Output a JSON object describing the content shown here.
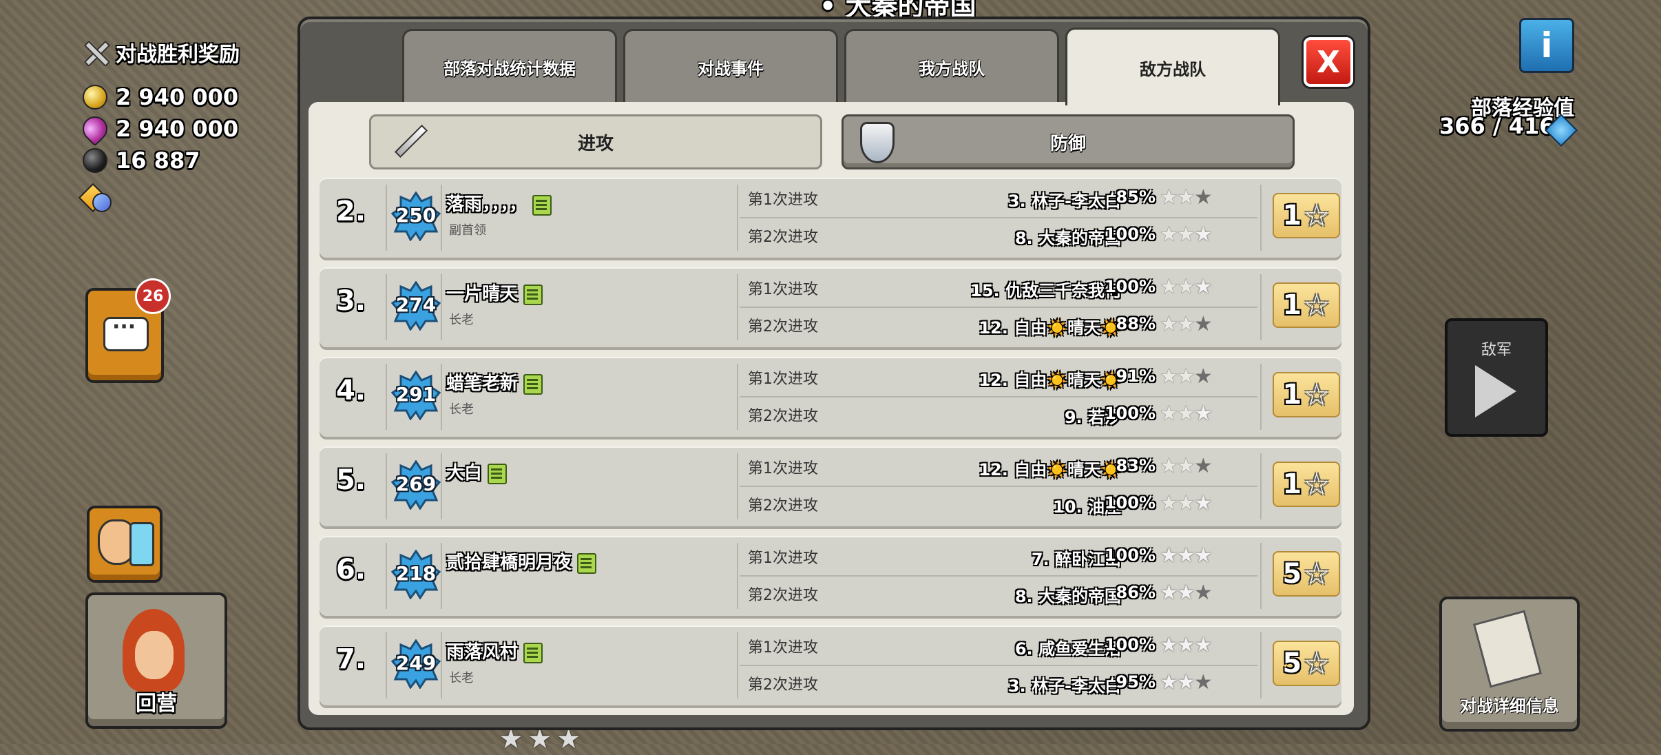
{
  "top_title": "• 大秦的帝国",
  "left": {
    "reward_title": "对战胜利奖励",
    "gold": "2 940 000",
    "elixir": "2 940 000",
    "dark_elixir": "16 887",
    "chat_badge": "26",
    "return_label": "回营"
  },
  "right": {
    "info_label": "i",
    "exp_label": "部落经验值",
    "exp_value": "366 / 416",
    "enemy_label": "敌军",
    "detail_label": "对战详细信息"
  },
  "tabs": [
    "部落对战统计数据",
    "对战事件",
    "我方战队",
    "敌方战队"
  ],
  "active_tab": 3,
  "close_label": "X",
  "segments": {
    "attack": "进攻",
    "defense": "防御"
  },
  "rows": [
    {
      "rank": "2.",
      "level": "250",
      "name": "落雨，，，，",
      "role": "副首领",
      "total": "1",
      "attacks": [
        {
          "label": "第1次进攻",
          "target": "3. 林子-李太白",
          "pct": "85%",
          "stars": [
            0,
            0,
            1
          ]
        },
        {
          "label": "第2次进攻",
          "target": "8. 大秦的帝国",
          "pct": "100%",
          "stars": [
            0,
            0,
            2
          ]
        }
      ]
    },
    {
      "rank": "3.",
      "level": "274",
      "name": "一片晴天",
      "role": "长老",
      "total": "1",
      "attacks": [
        {
          "label": "第1次进攻",
          "target": "15. 仇敌三千奈我何",
          "pct": "100%",
          "stars": [
            0,
            0,
            2
          ]
        },
        {
          "label": "第2次进攻",
          "target": "12. 自由☀️晴天☀️",
          "pct": "88%",
          "stars": [
            0,
            0,
            1
          ]
        }
      ]
    },
    {
      "rank": "4.",
      "level": "291",
      "name": "蜡笔老新",
      "role": "长老",
      "total": "1",
      "attacks": [
        {
          "label": "第1次进攻",
          "target": "12. 自由☀️晴天☀️",
          "pct": "91%",
          "stars": [
            0,
            0,
            1
          ]
        },
        {
          "label": "第2次进攻",
          "target": "9. 若汐",
          "pct": "100%",
          "stars": [
            0,
            0,
            2
          ]
        }
      ]
    },
    {
      "rank": "5.",
      "level": "269",
      "name": "大白",
      "role": "",
      "total": "1",
      "attacks": [
        {
          "label": "第1次进攻",
          "target": "12. 自由☀️晴天☀️",
          "pct": "83%",
          "stars": [
            0,
            0,
            1
          ]
        },
        {
          "label": "第2次进攻",
          "target": "10. 油庄",
          "pct": "100%",
          "stars": [
            0,
            0,
            2
          ]
        }
      ]
    },
    {
      "rank": "6.",
      "level": "218",
      "name": "贰拾肆橋明月夜",
      "role": "",
      "total": "5",
      "attacks": [
        {
          "label": "第1次进攻",
          "target": "7. 醉卧江山",
          "pct": "100%",
          "stars": [
            2,
            2,
            2
          ]
        },
        {
          "label": "第2次进攻",
          "target": "8. 大秦的帝国",
          "pct": "86%",
          "stars": [
            2,
            2,
            1
          ]
        }
      ]
    },
    {
      "rank": "7.",
      "level": "249",
      "name": "雨落风村",
      "role": "长老",
      "total": "5",
      "attacks": [
        {
          "label": "第1次进攻",
          "target": "6. 咸鱼爱生活",
          "pct": "100%",
          "stars": [
            2,
            2,
            2
          ]
        },
        {
          "label": "第2次进攻",
          "target": "3. 林子-李太白",
          "pct": "95%",
          "stars": [
            2,
            2,
            1
          ]
        }
      ]
    }
  ],
  "bottom_stars": "★★★",
  "colors": {
    "accent_gold": "#e6c06a",
    "close_red": "#c31a12",
    "badge_blue": "#3aa2e0"
  }
}
